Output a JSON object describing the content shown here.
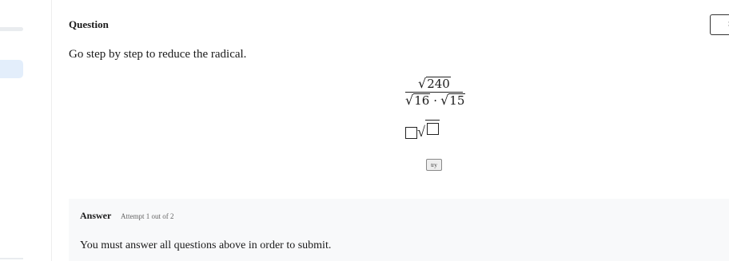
{
  "question": {
    "heading": "Question",
    "prompt": "Go step by step to reduce the radical.",
    "expression": {
      "numerator_radicand": "240",
      "denominator_left_radicand": "16",
      "operator": "·",
      "denominator_right_radicand": "15"
    },
    "try_button_label": "try",
    "corner_button_label": "S"
  },
  "answer": {
    "heading": "Answer",
    "attempt_label": "Attempt 1 out of 2",
    "message": "You must answer all questions above in order to submit."
  }
}
